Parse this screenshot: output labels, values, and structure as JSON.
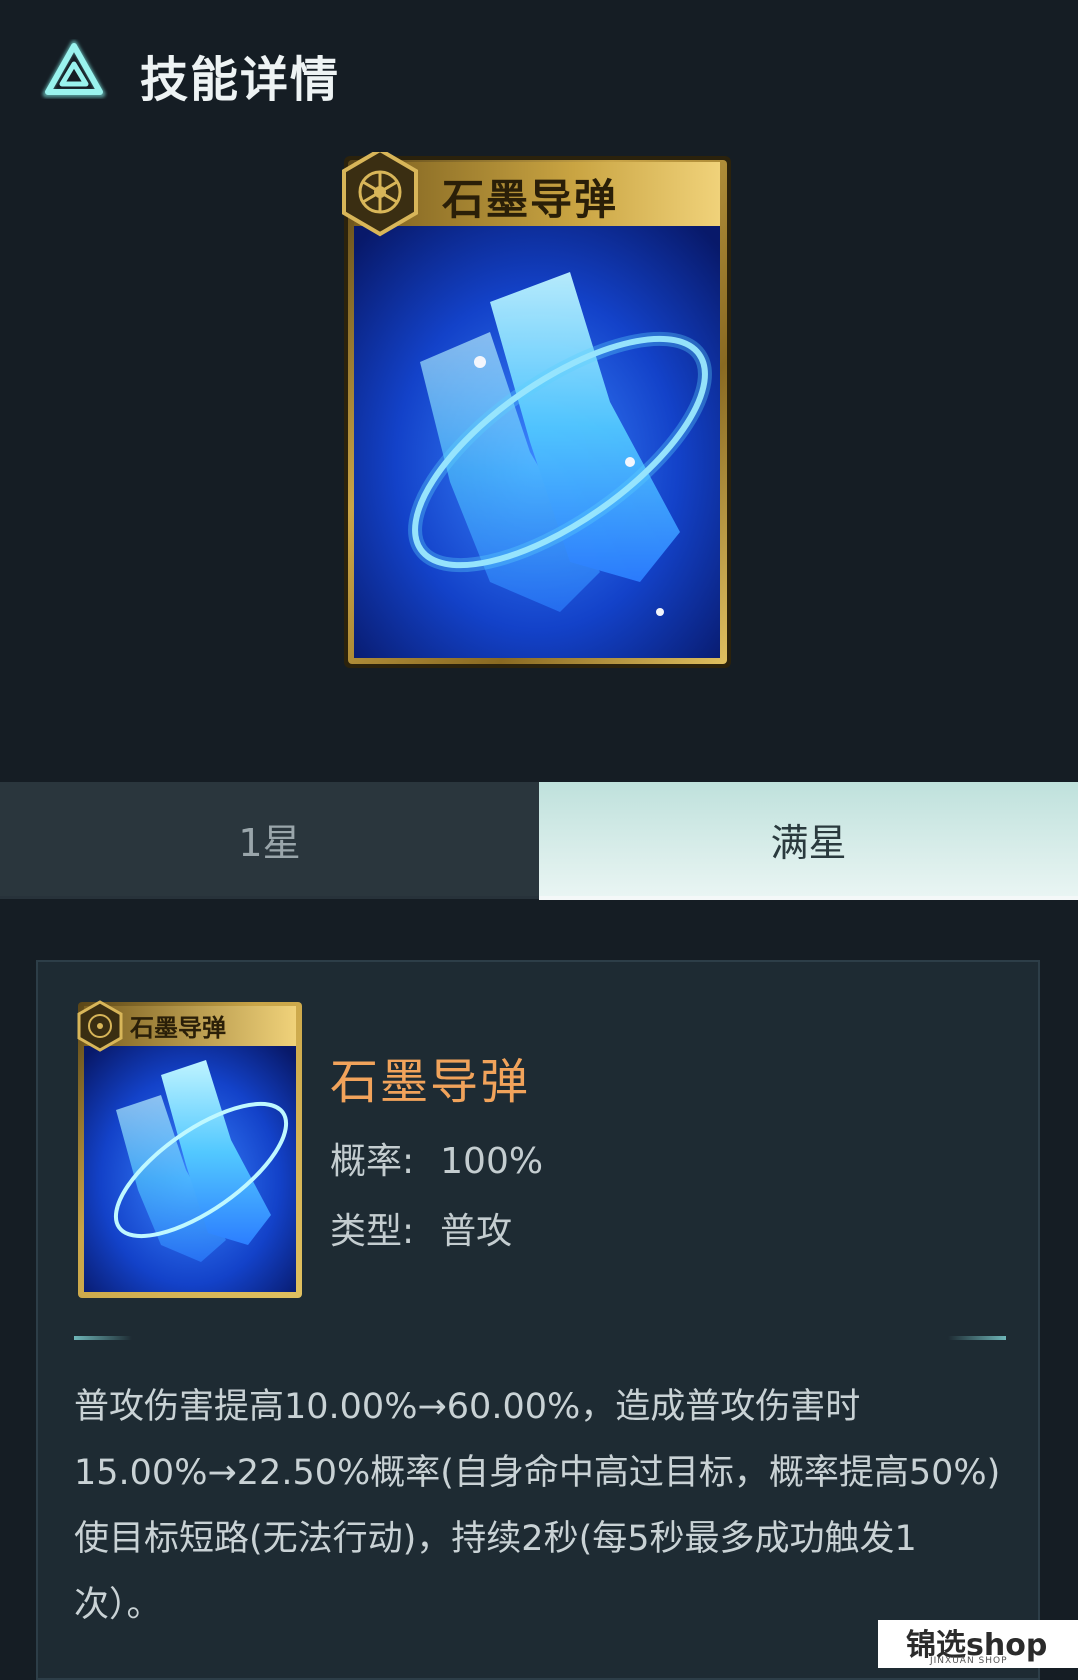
{
  "header": {
    "title": "技能详情",
    "logo_icon": "triangle-logo-icon"
  },
  "card": {
    "name": "石墨导弹",
    "emblem_icon": "hex-gear-emblem-icon",
    "art_icon": "blue-boots-art-icon"
  },
  "tabs": [
    {
      "label": "1星",
      "active": false
    },
    {
      "label": "满星",
      "active": true
    }
  ],
  "detail": {
    "name": "石墨导弹",
    "rate_label": "概率:",
    "rate_value": "100%",
    "type_label": "类型:",
    "type_value": "普攻",
    "description": "普攻伤害提高10.00%→60.00%，造成普攻伤害时15.00%→22.50%概率(自身命中高过目标，概率提高50%)使目标短路(无法行动)，持续2秒(每5秒最多成功触发1次）。"
  },
  "watermark": {
    "main": "锦选shop",
    "sub": "JINXUAN SHOP"
  },
  "colors": {
    "accent_orange": "#f1a35b",
    "active_tab": "#d6ecea",
    "background": "#151d24",
    "card_gold": "#b8923a",
    "card_blue": "#1a4fd0"
  }
}
